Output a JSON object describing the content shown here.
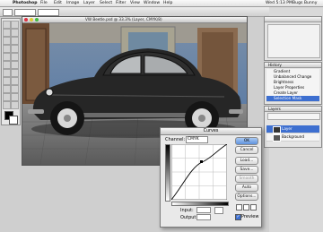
{
  "menu": {
    "app": "Photoshop",
    "items": [
      "File",
      "Edit",
      "Image",
      "Layer",
      "Select",
      "Filter",
      "View",
      "Window",
      "Help"
    ],
    "clock": "Wed 5:13 PM",
    "user": "Bugs Bunny"
  },
  "document": {
    "title": "VW Beetle.psd @ 33.3% (Layer, CMYK/8)"
  },
  "history_panel": {
    "title": "History",
    "items": [
      "Gradient",
      "Unbalanced Change",
      "Brightness",
      "Layer Properties",
      "Create Layer",
      "Selection Mask"
    ]
  },
  "layers_panel": {
    "title": "Layers",
    "items": [
      "Layer",
      "Background"
    ]
  },
  "curves_dialog": {
    "title": "Curves",
    "channel_label": "Channel:",
    "channel_value": "CMYK",
    "input_label": "Input:",
    "output_label": "Output:",
    "buttons": [
      "OK",
      "Cancel",
      "Load...",
      "Save...",
      "Smooth",
      "Auto",
      "Options..."
    ],
    "preview_label": "Preview"
  },
  "colors": {
    "accent": "#3d6fd0",
    "photo_wall": "#6f8fb4",
    "car_body": "#2b2b2b"
  }
}
